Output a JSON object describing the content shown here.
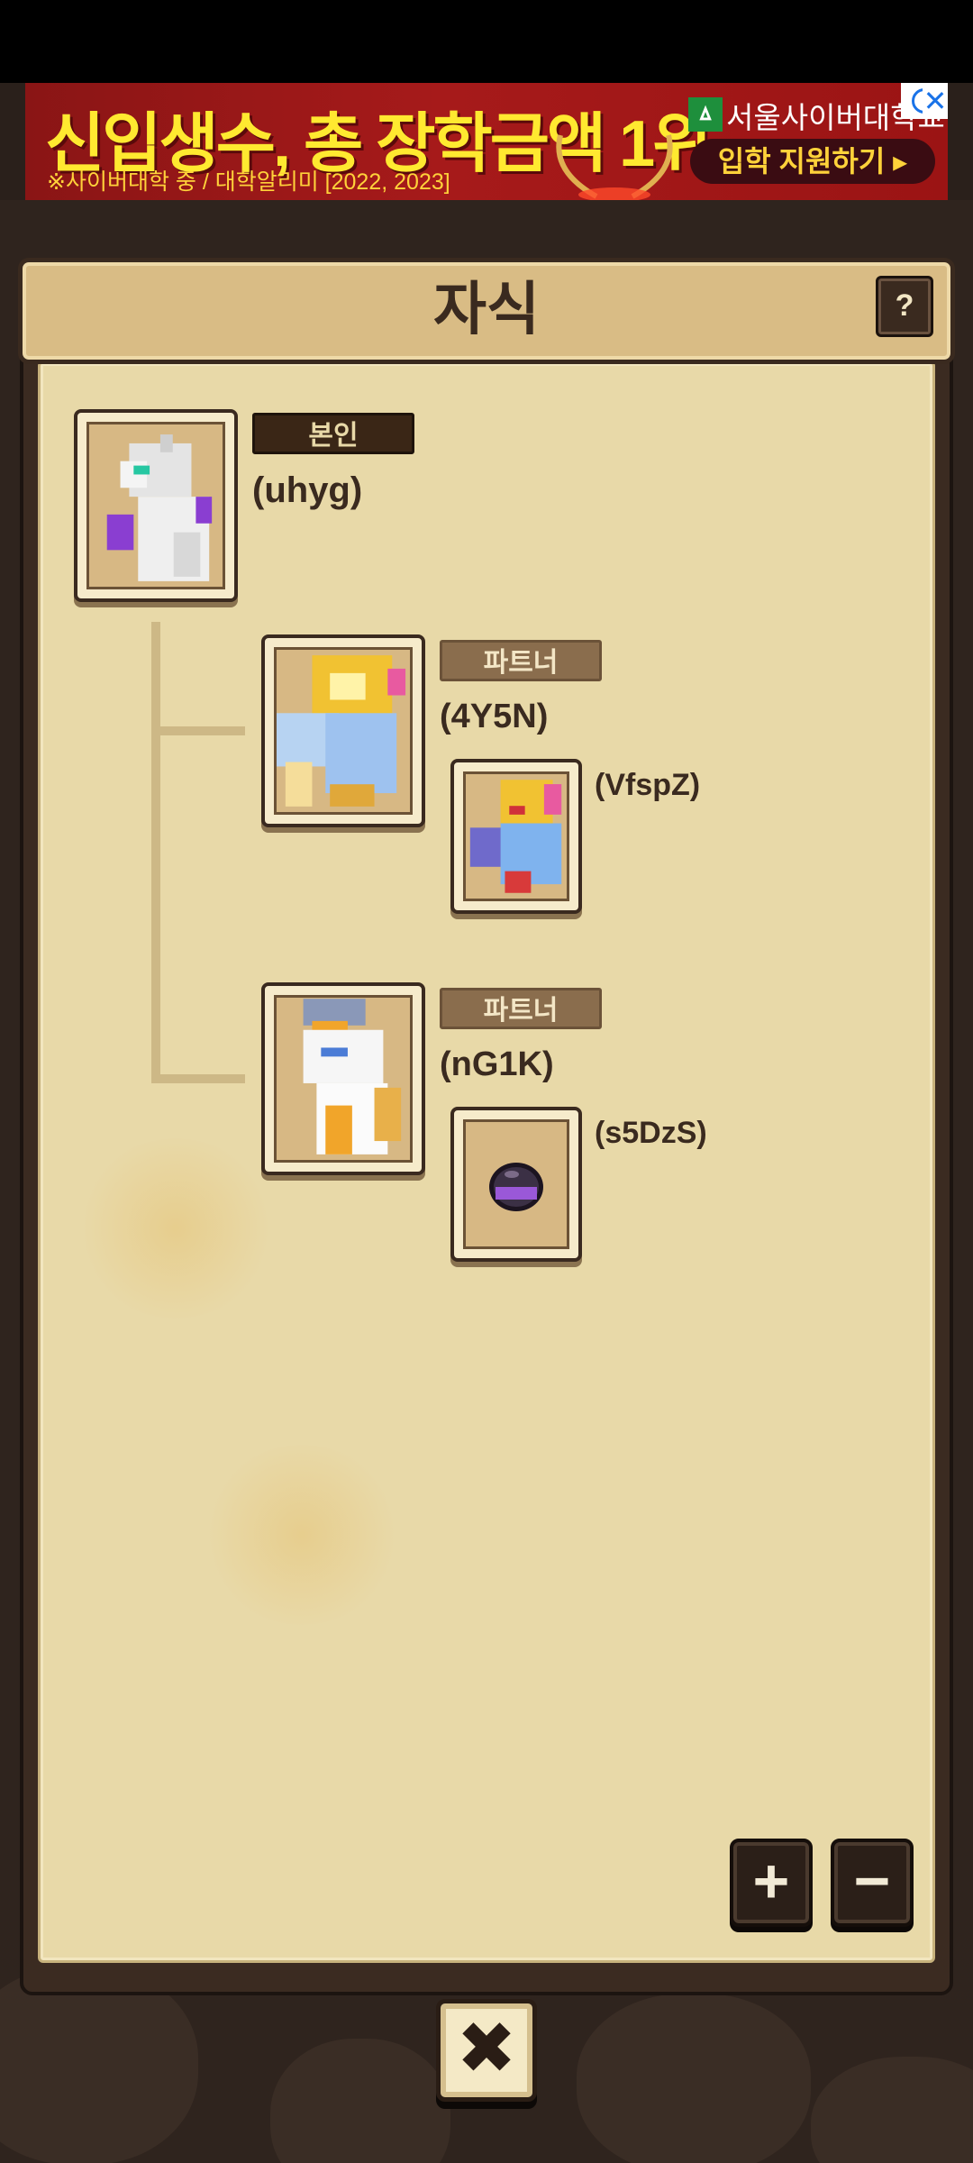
{
  "ad": {
    "headline": "신입생수, 총 장학금액 1위",
    "subtext": "※사이버대학 중 / 대학알리미 [2022, 2023]",
    "school_name": "서울사이버대학교",
    "cta_label": "입학 지원하기 ▸",
    "info_icon": "i",
    "close_icon": "✕"
  },
  "dialog": {
    "title": "자식",
    "help_label": "?"
  },
  "tree": {
    "self": {
      "badge": "본인",
      "name": "(uhyg)",
      "sprite": "white-purple-dragon"
    },
    "branches": [
      {
        "child": {
          "name": "(4Y5N)",
          "sprite": "gold-blue-dragon"
        },
        "partner_badge": "파트너",
        "offspring": {
          "name": "(VfspZ)",
          "sprite": "gold-blue-dragon-small"
        }
      },
      {
        "child": {
          "name": "(nG1K)",
          "sprite": "white-horned-dragon"
        },
        "partner_badge": "파트너",
        "offspring": {
          "name": "(s5DzS)",
          "sprite": "purple-egg"
        }
      }
    ]
  },
  "controls": {
    "zoom_in_label": "+",
    "zoom_out_label": "−",
    "close_label": "✖"
  },
  "colors": {
    "panel_bg": "#e8d9a8",
    "frame_dark": "#3a2a1f",
    "badge_self": "#3a2616",
    "badge_partner": "#8a6d4d",
    "ad_yellow": "#ffe930",
    "ad_red": "#a61a1a"
  }
}
